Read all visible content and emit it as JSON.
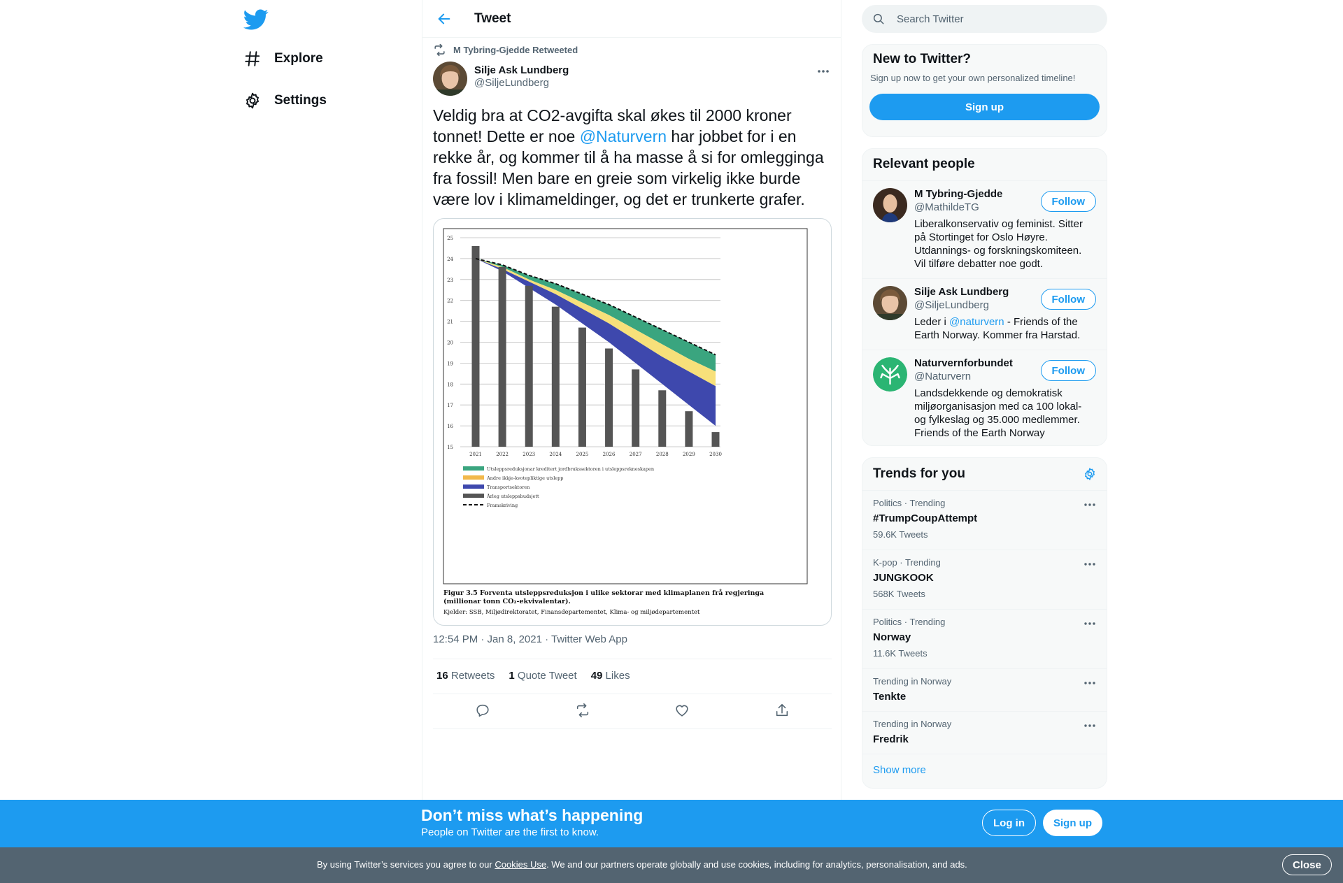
{
  "colors": {
    "accent": "#1d9bf0",
    "text": "#0f1419",
    "muted": "#536471",
    "banner": "#1d9bf0",
    "cookie_bar": "#536471"
  },
  "nav": {
    "logo": "twitter-bird-icon",
    "items": [
      {
        "label": "Explore",
        "icon": "hashtag-icon"
      },
      {
        "label": "Settings",
        "icon": "gear-icon"
      }
    ]
  },
  "header": {
    "title": "Tweet",
    "back_icon": "arrow-left-icon"
  },
  "tweet": {
    "retweeted_by": "M Tybring-Gjedde Retweeted",
    "author_name": "Silje Ask Lundberg",
    "author_handle": "@SiljeLundberg",
    "text_1": "Veldig bra at CO2-avgifta skal økes til 2000 kroner tonnet! Dette er noe ",
    "mention": "@Naturvern",
    "text_2": " har jobbet for i en rekke år, og kommer til å ha masse å si for omlegginga fra fossil! Men bare en greie som virkelig ikke burde være lov i klimameldinger, og det er trunkerte grafer.",
    "timestamp": "12:54 PM · Jan 8, 2021 · Twitter Web App",
    "retweets_count": "16",
    "retweets_label": "Retweets",
    "quotes_count": "1",
    "quotes_label": "Quote Tweet",
    "likes_count": "49",
    "likes_label": "Likes"
  },
  "chart_data": {
    "type": "area",
    "x": [
      "2021",
      "2022",
      "2023",
      "2024",
      "2025",
      "2026",
      "2027",
      "2028",
      "2029",
      "2030"
    ],
    "ylim": [
      15,
      25
    ],
    "yticks": [
      "15",
      "16",
      "17",
      "18",
      "19",
      "20",
      "21",
      "22",
      "23",
      "24",
      "25"
    ],
    "bars": {
      "name": "Årleg utsleppsbudsjett",
      "values": [
        24.6,
        23.6,
        22.7,
        21.7,
        20.7,
        19.7,
        18.7,
        17.7,
        16.7,
        15.7
      ]
    },
    "line": {
      "name": "Framskriving",
      "values": [
        24.0,
        23.7,
        23.2,
        22.8,
        22.3,
        21.8,
        21.2,
        20.6,
        20.0,
        19.4
      ]
    },
    "bands": [
      {
        "name": "Utsleppsreduksjonar kreditert jordbrukssektoren i utsleppsrekneskapen",
        "color": "#3aa57f",
        "top": [
          24.0,
          23.7,
          23.2,
          22.8,
          22.3,
          21.8,
          21.2,
          20.6,
          20.0,
          19.4
        ],
        "bottom": [
          24.0,
          23.6,
          23.0,
          22.5,
          21.9,
          21.3,
          20.6,
          19.9,
          19.2,
          18.6
        ]
      },
      {
        "name": "Andre ikkje-kvotepliktige utslepp",
        "color": "#f7e07a",
        "top": [
          24.0,
          23.6,
          23.0,
          22.5,
          21.9,
          21.3,
          20.6,
          19.9,
          19.2,
          18.6
        ],
        "bottom": [
          24.0,
          23.5,
          22.9,
          22.3,
          21.6,
          20.9,
          20.1,
          19.3,
          18.6,
          17.9
        ]
      },
      {
        "name": "Transportsektoren",
        "color": "#3e48ad",
        "top": [
          24.0,
          23.5,
          22.9,
          22.3,
          21.6,
          20.9,
          20.1,
          19.3,
          18.6,
          17.9
        ],
        "bottom": [
          24.0,
          23.4,
          22.6,
          21.8,
          20.9,
          20.0,
          19.0,
          18.0,
          17.0,
          16.0
        ]
      }
    ],
    "legend": [
      {
        "label": "Utsleppsreduksjonar kreditert jordbrukssektoren i utsleppsrekneskapen",
        "color": "#3aa57f"
      },
      {
        "label": "Andre ikkje-kvotepliktige utslepp",
        "color": "#f2b84b"
      },
      {
        "label": "Transportsektoren",
        "color": "#3e48ad"
      },
      {
        "label": "Årleg utsleppsbudsjett",
        "color": "#555555"
      },
      {
        "label": "Framskriving",
        "color": "#111111"
      }
    ],
    "caption": "Figur 3.5  Forventa utsleppsreduksjon i ulike sektorar med klimaplanen frå regjeringa (millionar tonn CO₂-ekvivalentar).",
    "source": "Kjelder: SSB, Miljødirektoratet, Finansdepartementet, Klima- og miljødepartementet"
  },
  "search": {
    "placeholder": "Search Twitter"
  },
  "signup_box": {
    "title": "New to Twitter?",
    "subtitle": "Sign up now to get your own personalized timeline!",
    "button": "Sign up"
  },
  "relevant": {
    "title": "Relevant people",
    "people": [
      {
        "name": "M Tybring-Gjedde",
        "handle": "@MathildeTG",
        "bio": "Liberalkonservativ og feminist. Sitter på Stortinget for Oslo Høyre. Utdannings- og forskningskomiteen. Vil tilføre debatter noe godt.",
        "follow": "Follow"
      },
      {
        "name": "Silje Ask Lundberg",
        "handle": "@SiljeLundberg",
        "bio_1": "Leder i ",
        "bio_mention": "@naturvern",
        "bio_2": " - Friends of the Earth Norway. Kommer fra Harstad.",
        "follow": "Follow"
      },
      {
        "name": "Naturvernforbundet",
        "handle": "@Naturvern",
        "bio": "Landsdekkende og demokratisk miljøorganisasjon med ca 100 lokal- og fylkeslag og 35.000 medlemmer. Friends of the Earth Norway",
        "follow": "Follow"
      }
    ]
  },
  "trends": {
    "title": "Trends for you",
    "items": [
      {
        "context": "Politics · Trending",
        "name": "#TrumpCoupAttempt",
        "count": "59.6K Tweets"
      },
      {
        "context": "K-pop · Trending",
        "name": "JUNGKOOK",
        "count": "568K Tweets"
      },
      {
        "context": "Politics · Trending",
        "name": "Norway",
        "count": "11.6K Tweets"
      },
      {
        "context": "Trending in Norway",
        "name": "Tenkte",
        "count": ""
      },
      {
        "context": "Trending in Norway",
        "name": "Fredrik",
        "count": ""
      }
    ],
    "show_more": "Show more"
  },
  "banner": {
    "title": "Don’t miss what’s happening",
    "subtitle": "People on Twitter are the first to know.",
    "login": "Log in",
    "signup": "Sign up"
  },
  "cookie": {
    "text_1": "By using Twitter’s services you agree to our ",
    "link": "Cookies Use",
    "text_2": ". We and our partners operate globally and use cookies, including for analytics, personalisation, and ads.",
    "close": "Close"
  }
}
